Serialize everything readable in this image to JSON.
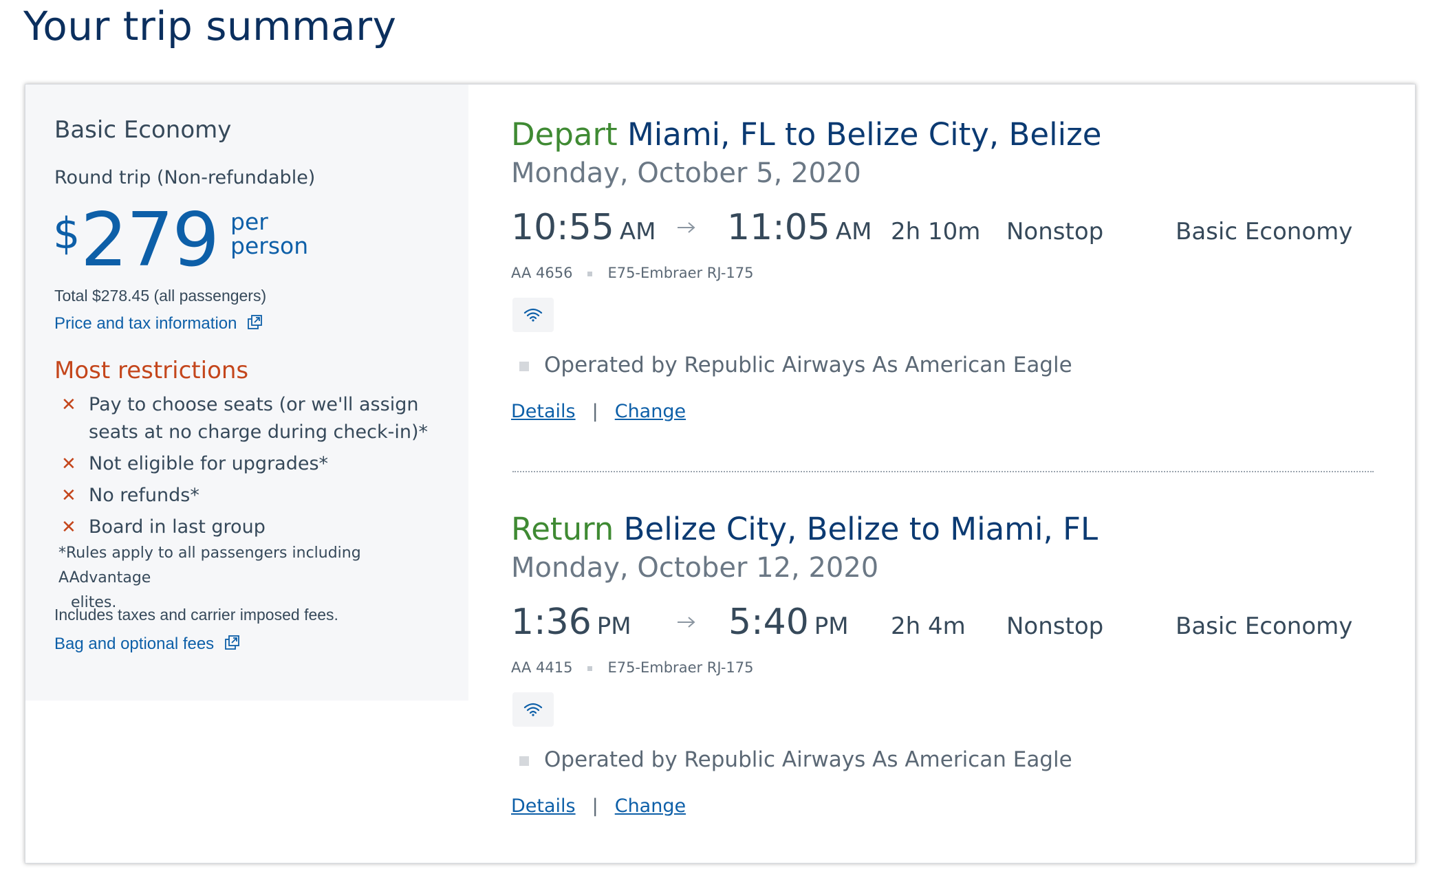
{
  "page": {
    "title": "Your trip summary"
  },
  "fare": {
    "name": "Basic Economy",
    "trip_type": "Round trip (Non-refundable)",
    "price_currency": "$",
    "price_amount": "279",
    "price_per_line1": "per",
    "price_per_line2": "person",
    "total": "Total $278.45 (all passengers)",
    "price_link": "Price and tax information",
    "restrictions_title": "Most restrictions",
    "restrictions": [
      {
        "text": "Pay to choose seats (or we'll assign seats at no charge during check-in)*"
      },
      {
        "text": "Not eligible for upgrades*"
      },
      {
        "text": "No refunds*"
      },
      {
        "text": "Board in last group"
      }
    ],
    "rules_note_line1": "*Rules apply to all passengers including AAdvantage",
    "rules_note_line2": "elites.",
    "includes": "Includes taxes and carrier imposed fees.",
    "bag_link": "Bag and optional fees"
  },
  "colors": {
    "brand_blue": "#0d5fa8",
    "title_navy": "#0b2f5e",
    "depart_green": "#3f8a33",
    "restriction_orange": "#c4461c"
  },
  "flights": [
    {
      "direction": "Depart",
      "route": "Miami, FL to Belize City, Belize",
      "date": "Monday, October 5, 2020",
      "depart_time": "10:55",
      "depart_ampm": "AM",
      "arrive_time": "11:05",
      "arrive_ampm": "AM",
      "duration": "2h  10m",
      "stops": "Nonstop",
      "cabin": "Basic Economy",
      "flight_number": "AA 4656",
      "aircraft": "E75-Embraer RJ-175",
      "amenity_icon": "wifi-icon",
      "operated_by": "Operated by Republic Airways As American Eagle",
      "details_label": "Details",
      "separator": "|",
      "change_label": "Change"
    },
    {
      "direction": "Return",
      "route": "Belize City, Belize to Miami, FL",
      "date": "Monday, October 12, 2020",
      "depart_time": "1:36",
      "depart_ampm": "PM",
      "arrive_time": "5:40",
      "arrive_ampm": "PM",
      "duration": "2h  4m",
      "stops": "Nonstop",
      "cabin": "Basic Economy",
      "flight_number": "AA 4415",
      "aircraft": "E75-Embraer RJ-175",
      "amenity_icon": "wifi-icon",
      "operated_by": "Operated by Republic Airways As American Eagle",
      "details_label": "Details",
      "separator": "|",
      "change_label": "Change"
    }
  ]
}
